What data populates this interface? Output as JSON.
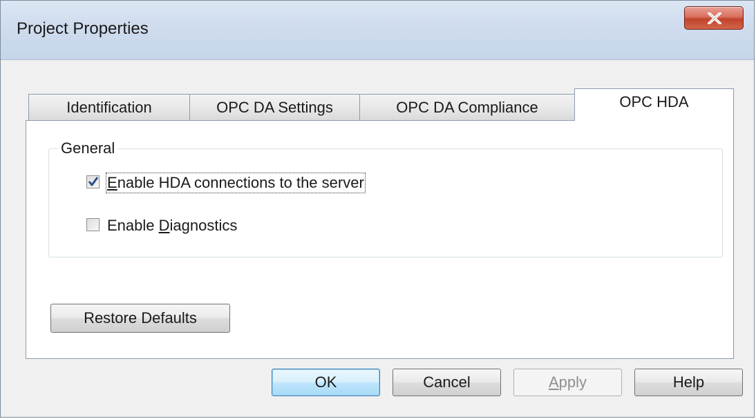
{
  "window": {
    "title": "Project Properties",
    "close_icon": "close-x-icon"
  },
  "tabs": [
    {
      "label": "Identification",
      "active": false
    },
    {
      "label": "OPC DA Settings",
      "active": false
    },
    {
      "label": "OPC DA Compliance",
      "active": false
    },
    {
      "label": "OPC HDA",
      "active": true
    }
  ],
  "general_group": {
    "label": "General",
    "options": [
      {
        "label_pre": "",
        "label_mnemonic": "E",
        "label_post": "nable HDA connections to the server",
        "checked": true,
        "focused": true
      },
      {
        "label_pre": "Enable ",
        "label_mnemonic": "D",
        "label_post": "iagnostics",
        "checked": false,
        "focused": false
      }
    ]
  },
  "restore_defaults_label": "Restore Defaults",
  "buttons": {
    "ok": {
      "label": "OK",
      "default": true
    },
    "cancel": {
      "label": "Cancel"
    },
    "apply": {
      "label_mnemonic": "A",
      "label_post": "pply",
      "enabled": false
    },
    "help": {
      "label": "Help"
    }
  },
  "colors": {
    "close_button": "#c2432c",
    "default_button_border": "#3c7fb1",
    "check_mark": "#2a4f8f"
  }
}
